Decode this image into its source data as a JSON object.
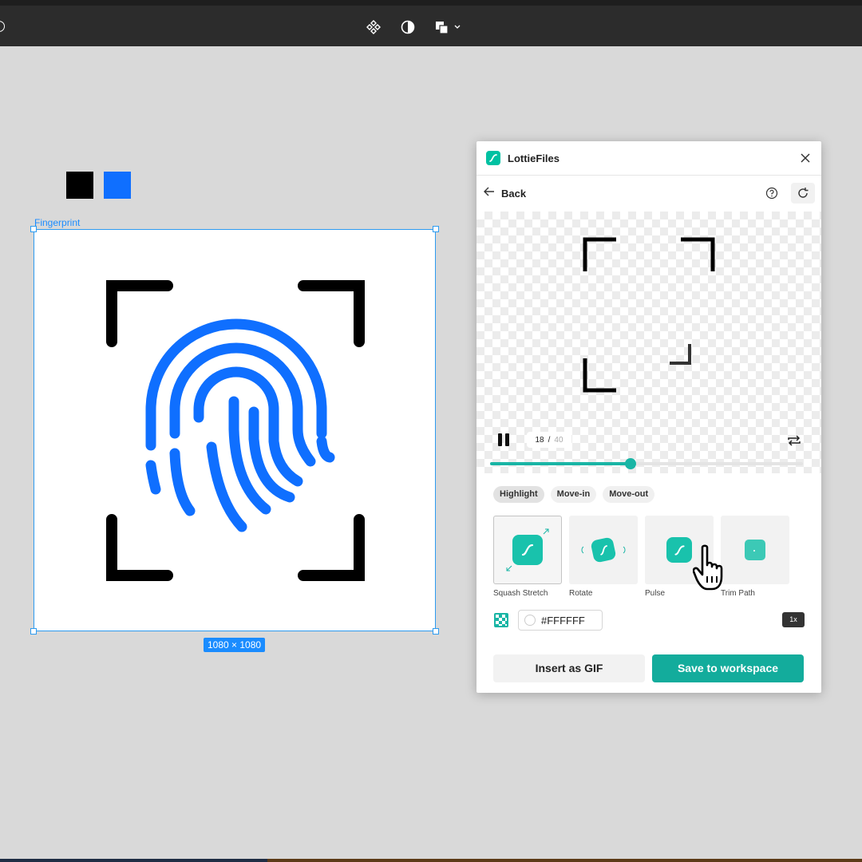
{
  "toolbar": {
    "icons": [
      "component-icon",
      "contrast-icon",
      "boolean-shapes-icon"
    ]
  },
  "canvas": {
    "swatches": [
      "#000000",
      "#0f6fff"
    ],
    "frame_label": "Fingerprint",
    "size_badge": "1080 × 1080"
  },
  "panel": {
    "title": "LottieFiles",
    "back_label": "Back",
    "player": {
      "current_frame": "18",
      "separator": "/",
      "total_frames": "40",
      "progress": 0.45
    },
    "tabs": [
      {
        "label": "Highlight",
        "active": true
      },
      {
        "label": "Move-in",
        "active": false
      },
      {
        "label": "Move-out",
        "active": false
      }
    ],
    "animations": [
      {
        "label": "Squash Stretch",
        "selected": true
      },
      {
        "label": "Rotate",
        "selected": false
      },
      {
        "label": "Pulse",
        "selected": false
      },
      {
        "label": "Trim Path",
        "selected": false
      }
    ],
    "background_color": "#FFFFFF",
    "speed": "1x",
    "insert_gif_label": "Insert as GIF",
    "save_label": "Save to workspace",
    "accent_color": "#13ac9c"
  }
}
